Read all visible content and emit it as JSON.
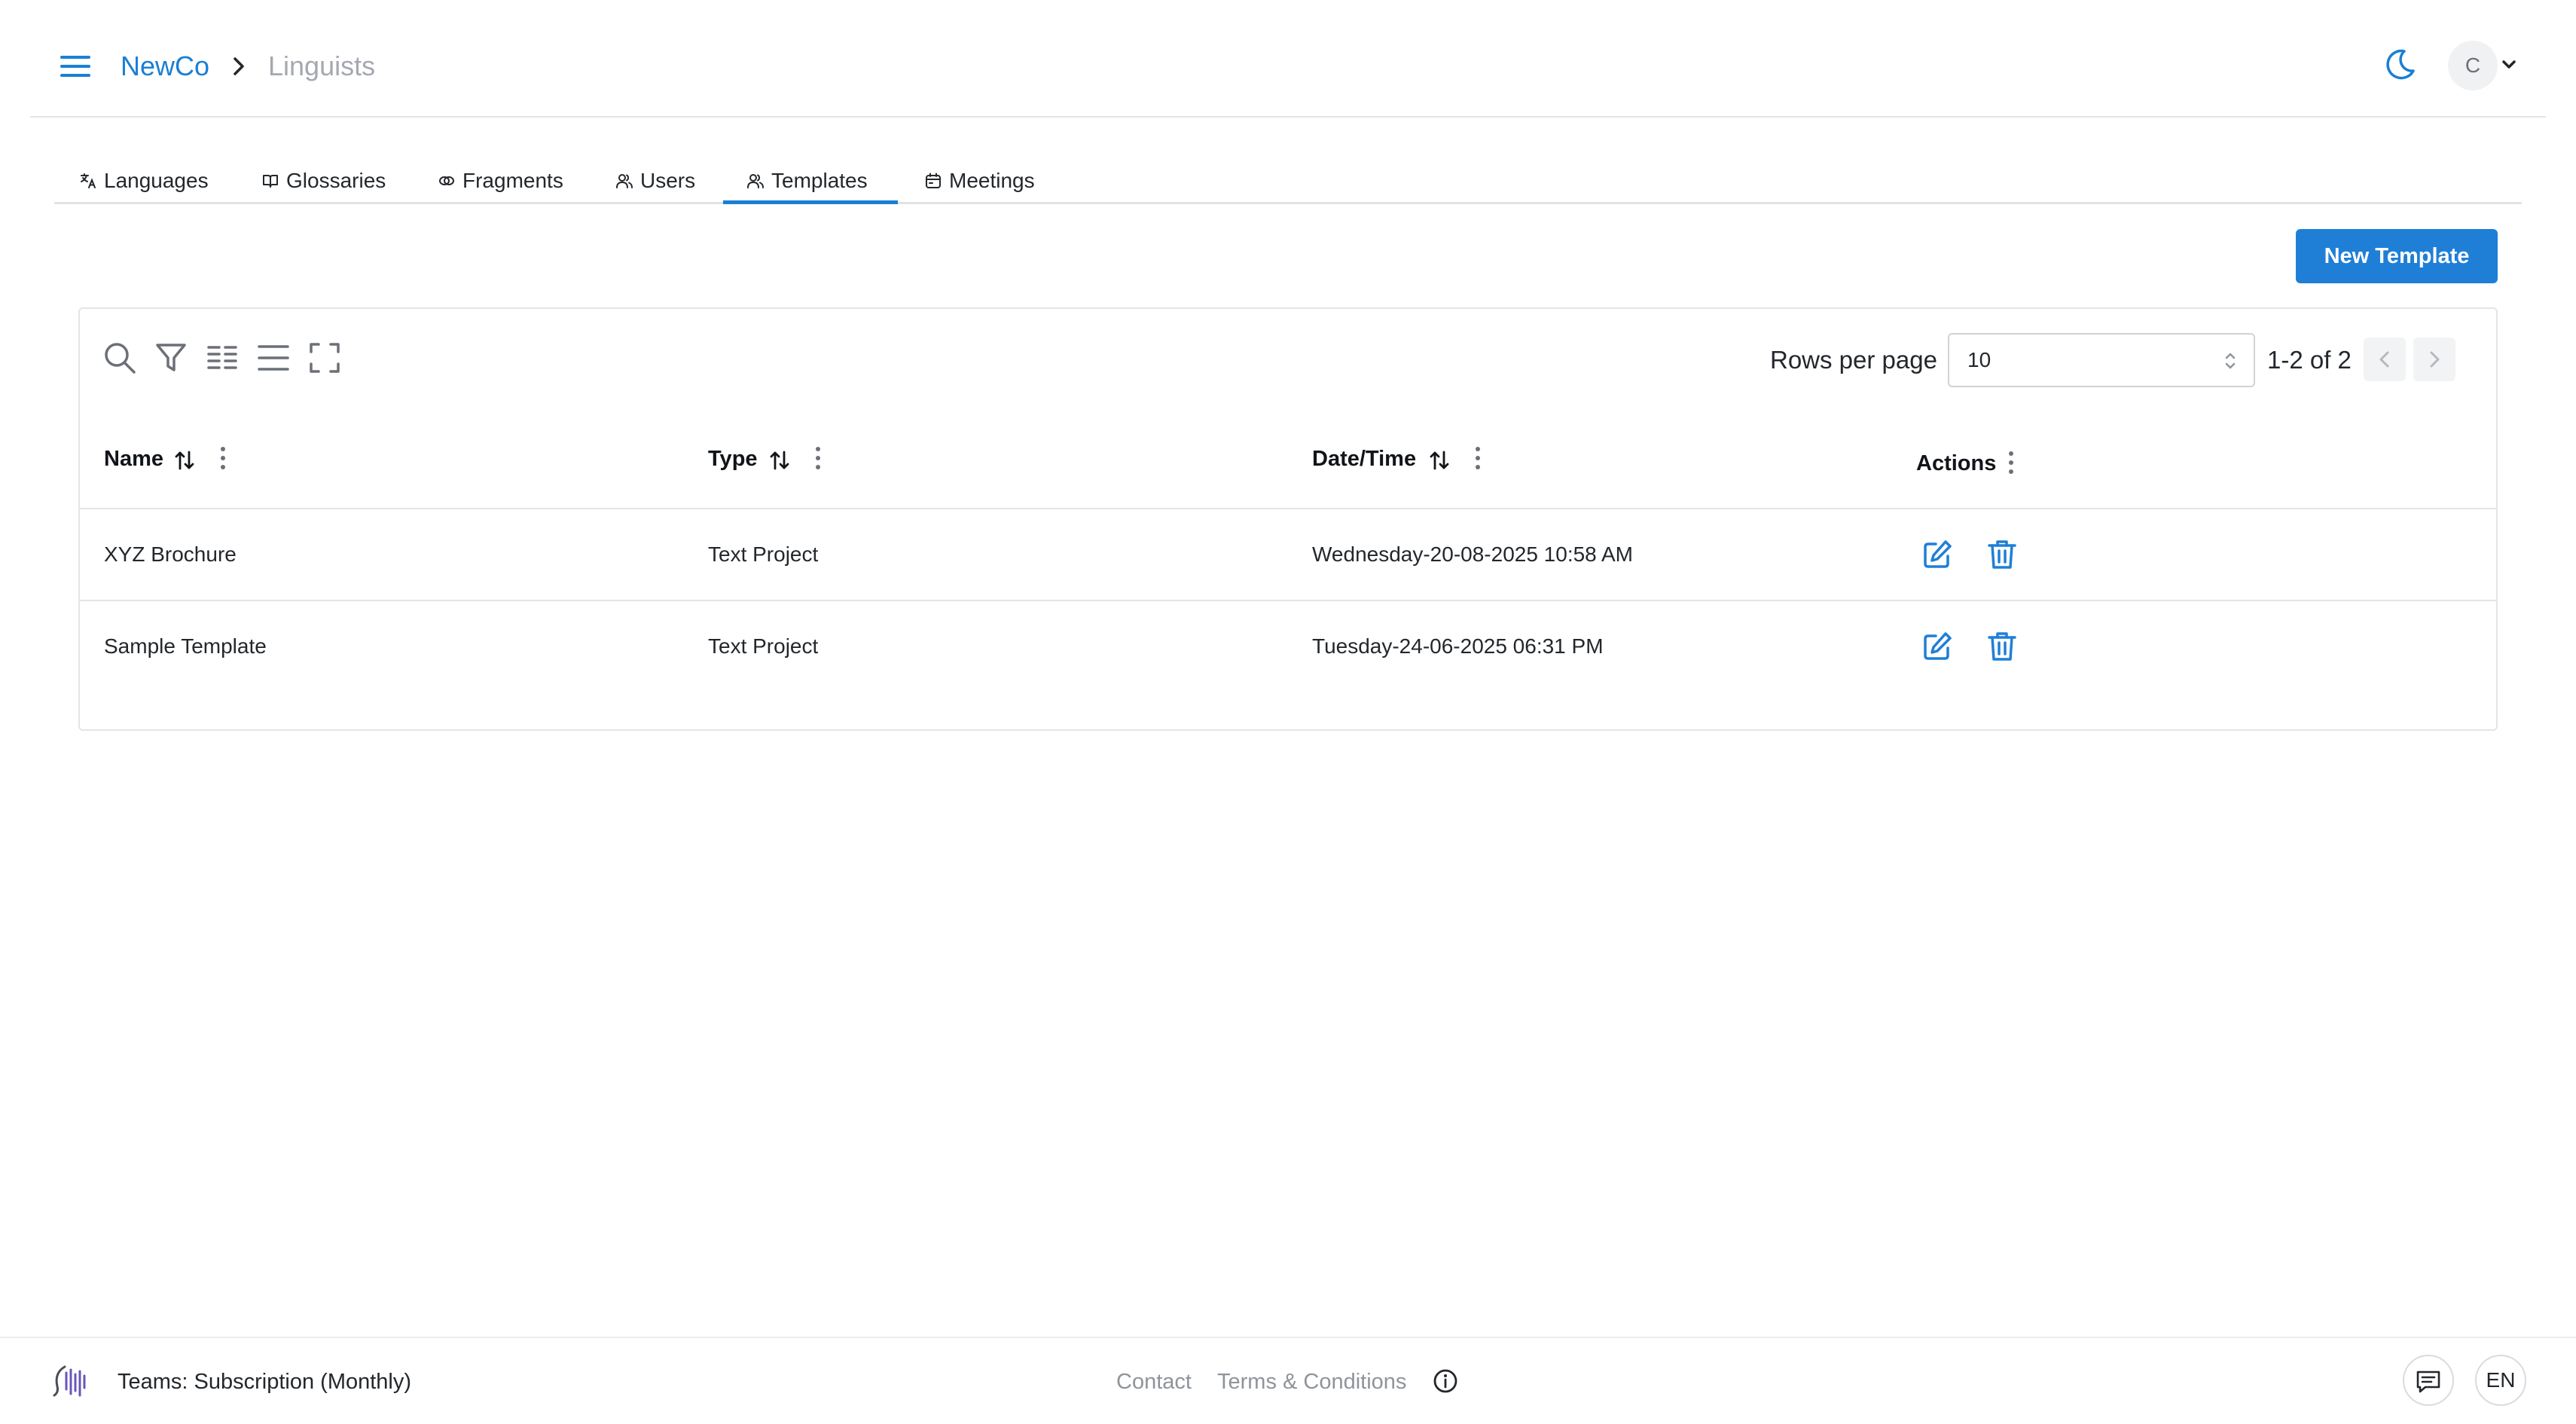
{
  "colors": {
    "accent": "#1f7fd6",
    "muted_text": "#a4a9b0",
    "border": "#e3e5e8"
  },
  "header": {
    "menu_icon": "hamburger-menu-icon",
    "breadcrumb": {
      "org": "NewCo",
      "current": "Linguists"
    },
    "theme_icon": "moon-icon",
    "avatar_initial": "C"
  },
  "tabs": [
    {
      "label": "Languages",
      "icon": "translate-icon"
    },
    {
      "label": "Glossaries",
      "icon": "book-icon"
    },
    {
      "label": "Fragments",
      "icon": "fragments-icon"
    },
    {
      "label": "Users",
      "icon": "users-icon"
    },
    {
      "label": "Templates",
      "icon": "users-icon",
      "active": true
    },
    {
      "label": "Meetings",
      "icon": "calendar-icon"
    }
  ],
  "toolbar": {
    "new_button": "New Template",
    "rows_per_page_label": "Rows per page",
    "rows_per_page_value": "10",
    "pagination_text": "1-2 of 2"
  },
  "table": {
    "columns": [
      "Name",
      "Type",
      "Date/Time",
      "Actions"
    ],
    "rows": [
      {
        "name": "XYZ Brochure",
        "type": "Text Project",
        "datetime": "Wednesday-20-08-2025 10:58 AM"
      },
      {
        "name": "Sample Template",
        "type": "Text Project",
        "datetime": "Tuesday-24-06-2025 06:31 PM"
      }
    ]
  },
  "footer": {
    "subscription": "Teams: Subscription (Monthly)",
    "contact": "Contact",
    "terms": "Terms & Conditions",
    "language": "EN"
  }
}
